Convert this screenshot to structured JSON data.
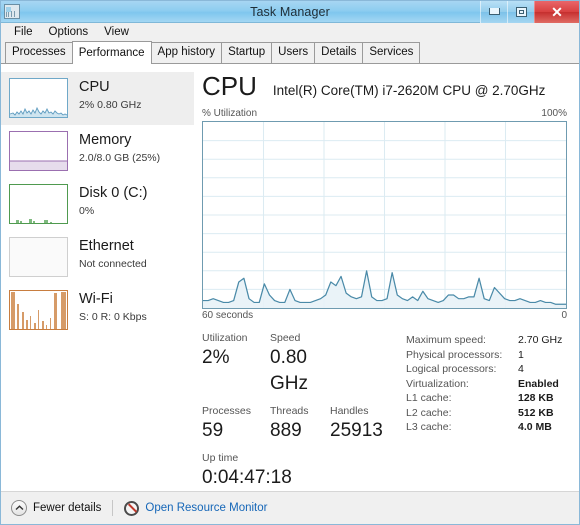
{
  "window": {
    "title": "Task Manager",
    "icon": "task-manager-icon",
    "controls": {
      "minimize": "–",
      "maximize": "□",
      "close": "✕"
    }
  },
  "menubar": {
    "items": [
      "File",
      "Options",
      "View"
    ]
  },
  "tabs": {
    "items": [
      "Processes",
      "Performance",
      "App history",
      "Startup",
      "Users",
      "Details",
      "Services"
    ],
    "active": "Performance"
  },
  "sidebar": {
    "items": [
      {
        "name": "CPU",
        "detail": "2%  0.80 GHz",
        "color": "#6fa8c8",
        "selected": true
      },
      {
        "name": "Memory",
        "detail": "2.0/8.0 GB (25%)",
        "color": "#9b6fb0",
        "selected": false
      },
      {
        "name": "Disk 0 (C:)",
        "detail": "0%",
        "color": "#4f9a4f",
        "selected": false
      },
      {
        "name": "Ethernet",
        "detail": "Not connected",
        "color": "#bdbdbd",
        "selected": false
      },
      {
        "name": "Wi-Fi",
        "detail": "S: 0 R: 0 Kbps",
        "color": "#c87d3f",
        "selected": false
      }
    ]
  },
  "main": {
    "title": "CPU",
    "subtitle": "Intel(R) Core(TM) i7-2620M CPU @ 2.70GHz",
    "axis_top_left": "% Utilization",
    "axis_top_right": "100%",
    "axis_bottom_left": "60 seconds",
    "axis_bottom_right": "0",
    "stats": {
      "utilization_label": "Utilization",
      "utilization_value": "2%",
      "speed_label": "Speed",
      "speed_value": "0.80 GHz",
      "processes_label": "Processes",
      "processes_value": "59",
      "threads_label": "Threads",
      "threads_value": "889",
      "handles_label": "Handles",
      "handles_value": "25913",
      "uptime_label": "Up time",
      "uptime_value": "0:04:47:18"
    },
    "info": [
      {
        "label": "Maximum speed:",
        "value": "2.70 GHz",
        "bold": false
      },
      {
        "label": "Physical processors:",
        "value": "1",
        "bold": false
      },
      {
        "label": "Logical processors:",
        "value": "4",
        "bold": false
      },
      {
        "label": "Virtualization:",
        "value": "Enabled",
        "bold": true
      },
      {
        "label": "L1 cache:",
        "value": "128 KB",
        "bold": true
      },
      {
        "label": "L2 cache:",
        "value": "512 KB",
        "bold": true
      },
      {
        "label": "L3 cache:",
        "value": "4.0 MB",
        "bold": true
      }
    ]
  },
  "statusbar": {
    "fewer_details": "Fewer details",
    "resource_monitor": "Open Resource Monitor"
  },
  "chart_data": {
    "type": "area",
    "title": "CPU % Utilization",
    "xlabel": "60 seconds",
    "ylabel": "% Utilization",
    "ylim": [
      0,
      100
    ],
    "xlim": [
      60,
      0
    ],
    "grid": true,
    "line_color": "#4a8aa8",
    "fill_color": "#e8f2f7",
    "gridlines_x": 5,
    "gridlines_y": 10,
    "values": [
      4,
      4,
      5,
      4,
      3,
      3,
      4,
      14,
      16,
      5,
      3,
      3,
      13,
      7,
      4,
      3,
      3,
      10,
      4,
      3,
      3,
      3,
      4,
      5,
      7,
      14,
      12,
      17,
      8,
      6,
      5,
      6,
      20,
      6,
      4,
      4,
      5,
      19,
      7,
      5,
      4,
      6,
      4,
      9,
      5,
      4,
      3,
      4,
      7,
      7,
      5,
      5,
      6,
      6,
      16,
      5,
      4,
      11,
      8,
      5,
      4,
      4,
      5,
      4,
      3,
      3,
      4,
      3,
      3,
      2,
      2,
      2
    ]
  }
}
